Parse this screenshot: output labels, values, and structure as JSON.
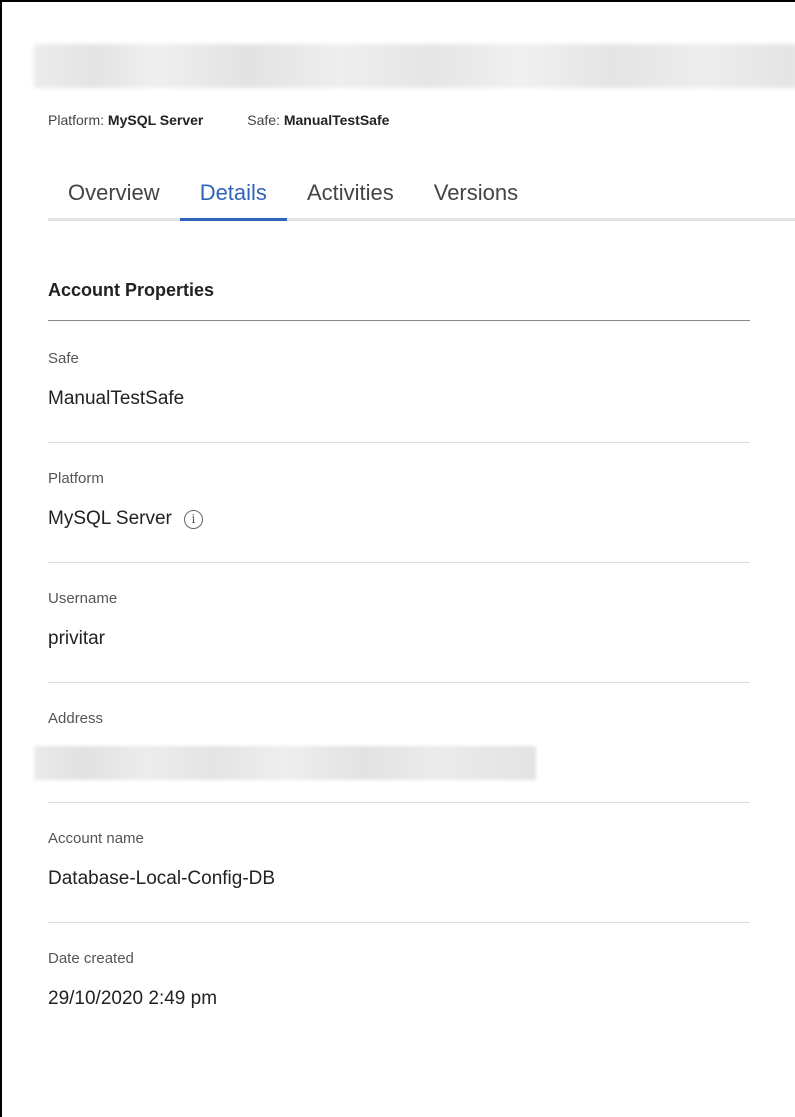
{
  "header": {
    "title_redacted": true,
    "platform_key": "Platform:",
    "platform_value": "MySQL Server",
    "safe_key": "Safe:",
    "safe_value": "ManualTestSafe"
  },
  "tabs": [
    {
      "label": "Overview",
      "active": false
    },
    {
      "label": "Details",
      "active": true
    },
    {
      "label": "Activities",
      "active": false
    },
    {
      "label": "Versions",
      "active": false
    }
  ],
  "section": {
    "title": "Account Properties"
  },
  "properties": [
    {
      "label": "Safe",
      "value": "ManualTestSafe"
    },
    {
      "label": "Platform",
      "value": "MySQL Server",
      "info_icon": "info-icon"
    },
    {
      "label": "Username",
      "value": "privitar"
    },
    {
      "label": "Address",
      "value_redacted": true
    },
    {
      "label": "Account name",
      "value": "Database-Local-Config-DB"
    },
    {
      "label": "Date created",
      "value": "29/10/2020 2:49 pm"
    }
  ],
  "colors": {
    "accent": "#2f63b9",
    "text": "#222222",
    "muted": "#555555",
    "divider": "#dcdcdc"
  }
}
